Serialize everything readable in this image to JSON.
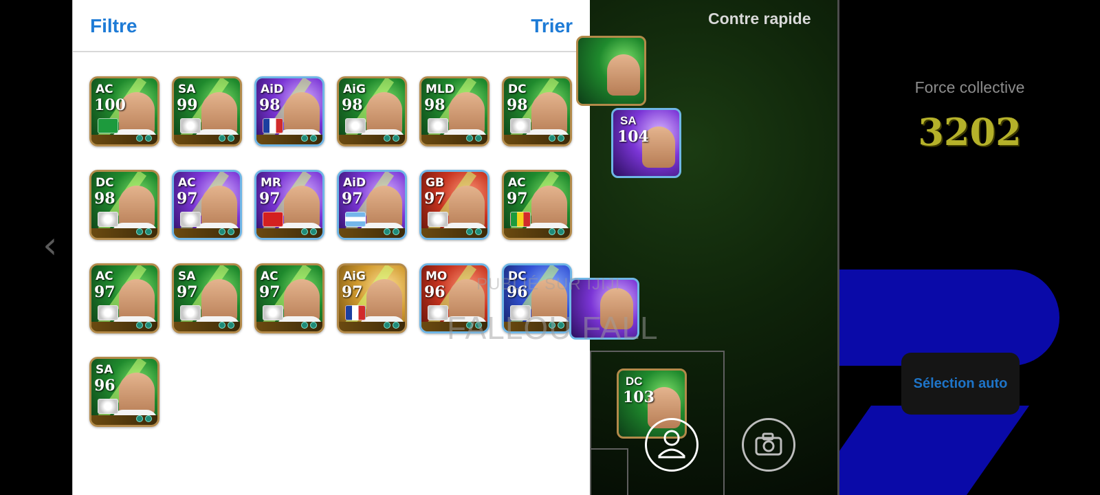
{
  "left_nav": {
    "arrow_glyph": "‹"
  },
  "panel": {
    "filter_label": "Filtre",
    "sort_label": "Trier",
    "cards": [
      {
        "pos": "AC",
        "rating": "100",
        "style": "green",
        "flag": "brazil"
      },
      {
        "pos": "SA",
        "rating": "99",
        "style": "green",
        "flag": "club-badge"
      },
      {
        "pos": "AiD",
        "rating": "98",
        "style": "purple",
        "flag": "france"
      },
      {
        "pos": "AiG",
        "rating": "98",
        "style": "green",
        "flag": "club-badge"
      },
      {
        "pos": "MLD",
        "rating": "98",
        "style": "green",
        "flag": "club-badge"
      },
      {
        "pos": "DC",
        "rating": "98",
        "style": "green",
        "flag": "club-badge"
      },
      {
        "pos": "DC",
        "rating": "98",
        "style": "green",
        "flag": "club-badge"
      },
      {
        "pos": "AC",
        "rating": "97",
        "style": "purple",
        "flag": "club-badge"
      },
      {
        "pos": "MR",
        "rating": "97",
        "style": "purple",
        "flag": "turkey"
      },
      {
        "pos": "AiD",
        "rating": "97",
        "style": "purple",
        "flag": "argentina"
      },
      {
        "pos": "GB",
        "rating": "97",
        "style": "red",
        "flag": "club-badge"
      },
      {
        "pos": "AC",
        "rating": "97",
        "style": "green",
        "flag": "senegal"
      },
      {
        "pos": "AC",
        "rating": "97",
        "style": "green",
        "flag": "club-badge"
      },
      {
        "pos": "SA",
        "rating": "97",
        "style": "green",
        "flag": "club-badge"
      },
      {
        "pos": "AC",
        "rating": "97",
        "style": "green",
        "flag": "club-badge"
      },
      {
        "pos": "AiG",
        "rating": "97",
        "style": "gold",
        "flag": "france"
      },
      {
        "pos": "MO",
        "rating": "96",
        "style": "red",
        "flag": "club-badge"
      },
      {
        "pos": "DC",
        "rating": "96",
        "style": "blue",
        "flag": "club-badge"
      },
      {
        "pos": "SA",
        "rating": "96",
        "style": "green",
        "flag": "club-badge"
      }
    ]
  },
  "field": {
    "mode_label": "Contre rapide",
    "cards": [
      {
        "pos": "SA",
        "rating": "104",
        "style": "purple"
      },
      {
        "pos": "DC",
        "rating": "103",
        "style": "green"
      }
    ]
  },
  "team": {
    "strength_label": "Force collective",
    "strength_value": "3202",
    "auto_select_label": "Sélection auto"
  },
  "icons": {
    "profile": "user-icon",
    "camera": "camera-icon"
  },
  "colors": {
    "accent": "#1e7bd6",
    "strength": "#b5b12a"
  },
  "watermark": {
    "line1": "PUBLIÉ SUR IJIJI",
    "line2": "FALLOU FALL"
  }
}
